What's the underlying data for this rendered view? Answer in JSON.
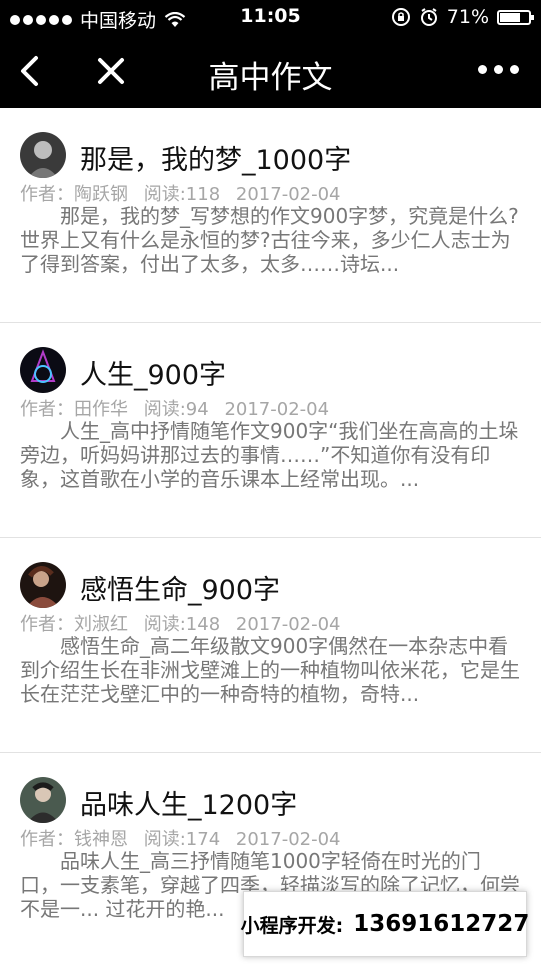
{
  "status_bar": {
    "carrier": "中国移动",
    "time": "11:05",
    "battery_text": "71%",
    "battery_level": 0.71
  },
  "nav": {
    "title": "高中作文"
  },
  "articles": [
    {
      "title": "那是，我的梦_1000字",
      "author": "作者：陶跃钢",
      "reads": "阅读:118",
      "date": "2017-02-04",
      "excerpt": "那是，我的梦_写梦想的作文900字梦，究竟是什么?世界上又有什么是永恒的梦?古往今来，多少仁人志士为了得到答案，付出了太多，太多……诗坛..."
    },
    {
      "title": "人生_900字",
      "author": "作者：田作华",
      "reads": "阅读:94",
      "date": "2017-02-04",
      "excerpt": "人生_高中抒情随笔作文900字“我们坐在高高的土垛旁边，听妈妈讲那过去的事情……”不知道你有没有印象，这首歌在小学的音乐课本上经常出现。..."
    },
    {
      "title": "感悟生命_900字",
      "author": "作者：刘淑红",
      "reads": "阅读:148",
      "date": "2017-02-04",
      "excerpt": "感悟生命_高二年级散文900字偶然在一本杂志中看到介绍生长在非洲戈壁滩上的一种植物叫依米花，它是生长在茫茫戈壁汇中的一种奇特的植物，奇特..."
    },
    {
      "title": "品味人生_1200字",
      "author": "作者：钱神恩",
      "reads": "阅读:174",
      "date": "2017-02-04",
      "excerpt": "品味人生_高三抒情随笔1000字轻倚在时光的门口，一支素笔，穿越了四季，轻描淡写的除了记忆，何尝不是一... 过花开的艳..."
    }
  ],
  "promo": {
    "label": "小程序开发:",
    "phone": "13691612727"
  },
  "colors": {
    "bar_background": "#000000",
    "meta_text": "#a6a6a6",
    "excerpt_text": "#777777"
  }
}
